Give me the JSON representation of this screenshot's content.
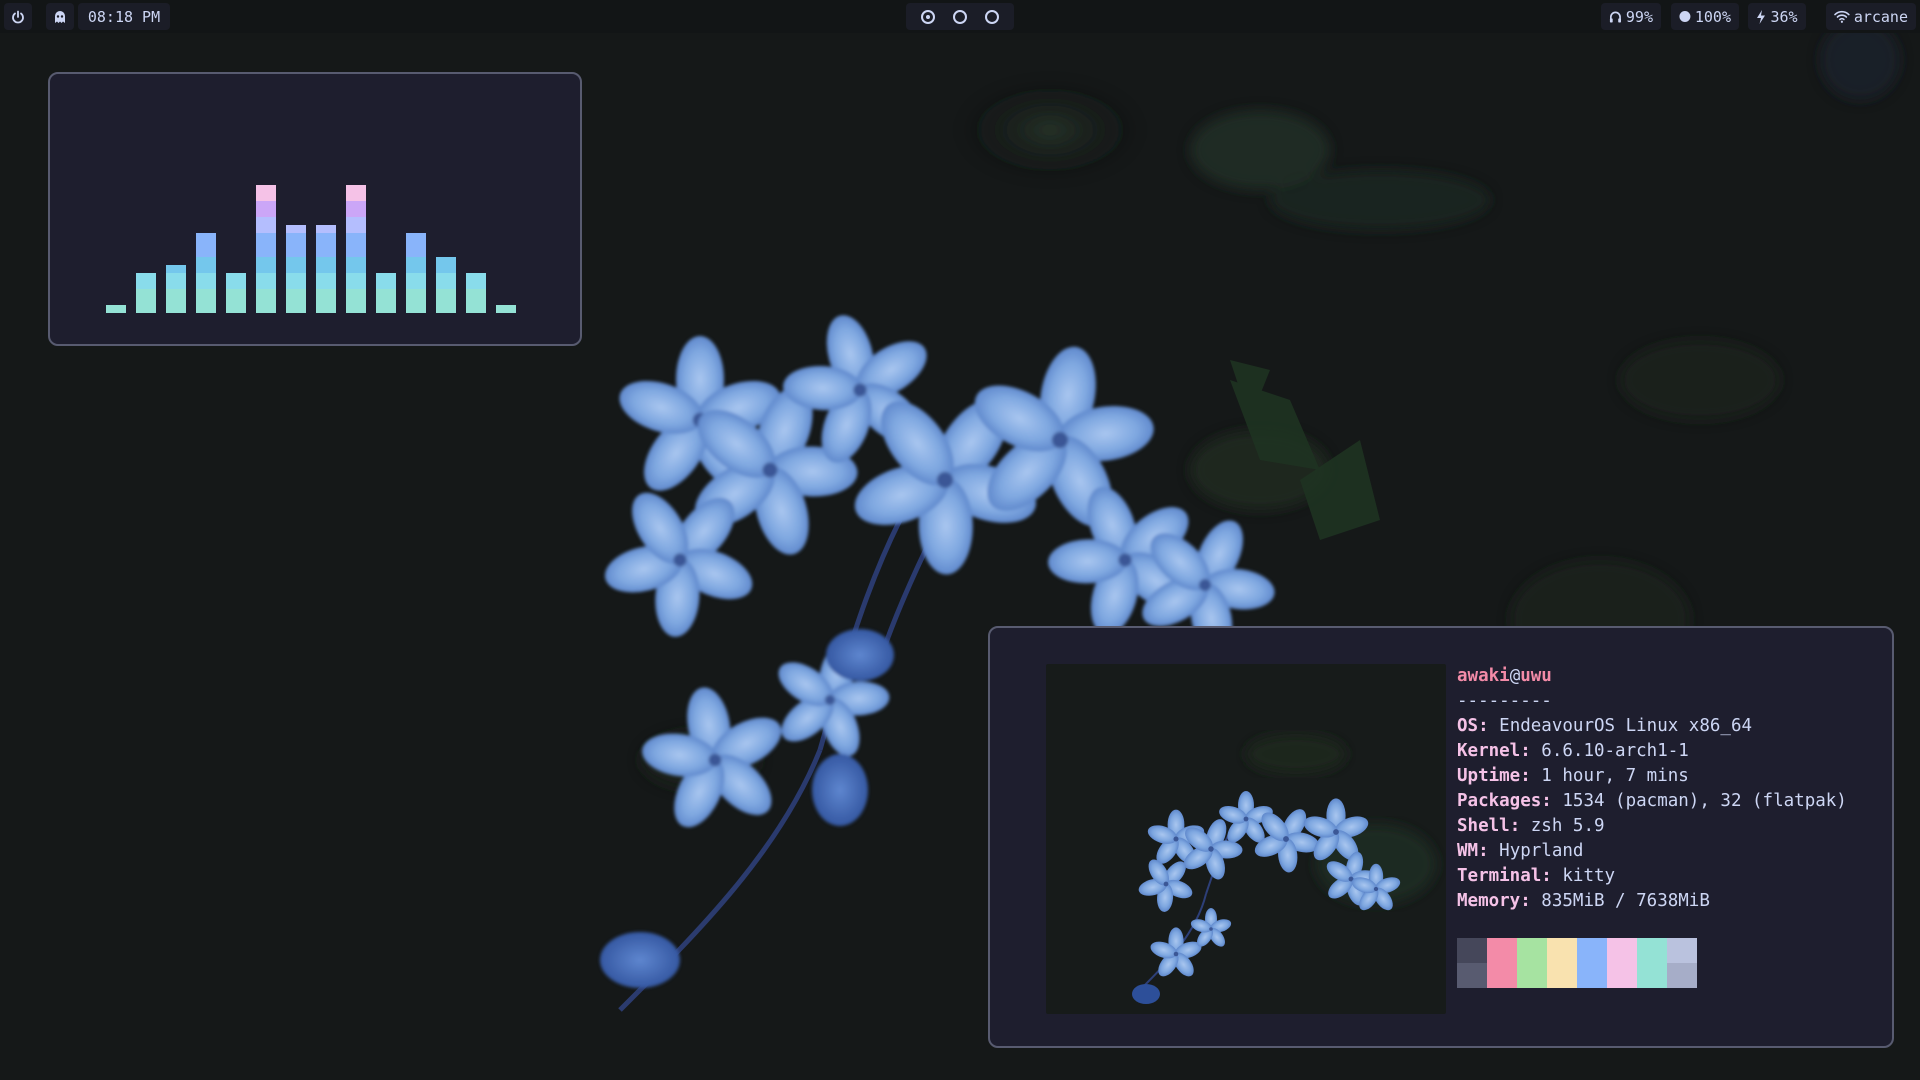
{
  "topbar": {
    "power_icon": "power-icon",
    "ghost_icon": "ghost-icon",
    "clock": "08:18 PM",
    "workspaces": [
      {
        "active": true
      },
      {
        "active": false
      },
      {
        "active": false
      }
    ],
    "headphones": {
      "icon": "headphones-icon",
      "value": "99%"
    },
    "brightness": {
      "icon": "brightness-icon",
      "value": "100%"
    },
    "battery": {
      "icon": "lightning-icon",
      "value": "36%"
    },
    "network": {
      "icon": "wifi-icon",
      "value": "arcane"
    }
  },
  "visualizer": {
    "levels": [
      1,
      5,
      6,
      10,
      5,
      16,
      11,
      11,
      16,
      5,
      10,
      7,
      5,
      1
    ],
    "max_level": 16,
    "gradient": [
      "#94e2d5",
      "#89dceb",
      "#74c7ec",
      "#89b4fa",
      "#b4befe",
      "#cba6f7",
      "#f5c2e7"
    ]
  },
  "fetch": {
    "user": "awaki",
    "at": "@",
    "host": "uwu",
    "separator": "---------",
    "rows": [
      {
        "key": "OS",
        "value": "EndeavourOS Linux x86_64"
      },
      {
        "key": "Kernel",
        "value": "6.6.10-arch1-1"
      },
      {
        "key": "Uptime",
        "value": "1 hour, 7 mins"
      },
      {
        "key": "Packages",
        "value": "1534 (pacman), 32 (flatpak)"
      },
      {
        "key": "Shell",
        "value": "zsh 5.9"
      },
      {
        "key": "WM",
        "value": "Hyprland"
      },
      {
        "key": "Terminal",
        "value": "kitty"
      },
      {
        "key": "Memory",
        "value": "835MiB / 7638MiB"
      }
    ],
    "palette_top": [
      "#45475a",
      "#f38ba8",
      "#a6e3a1",
      "#f9e2af",
      "#89b4fa",
      "#f5c2e7",
      "#94e2d5",
      "#bac2de"
    ],
    "palette_bottom": [
      "#585b70",
      "#f38ba8",
      "#a6e3a1",
      "#f9e2af",
      "#89b4fa",
      "#f5c2e7",
      "#94e2d5",
      "#a6adc8"
    ]
  },
  "colors": {
    "bar_bg": "#121516",
    "pill_bg": "#1b1d27",
    "panel_bg": "#1e1e2e",
    "panel_border": "#585b70",
    "text": "#cdd6f4",
    "key": "#f5c2e7",
    "user": "#f38ba8"
  }
}
